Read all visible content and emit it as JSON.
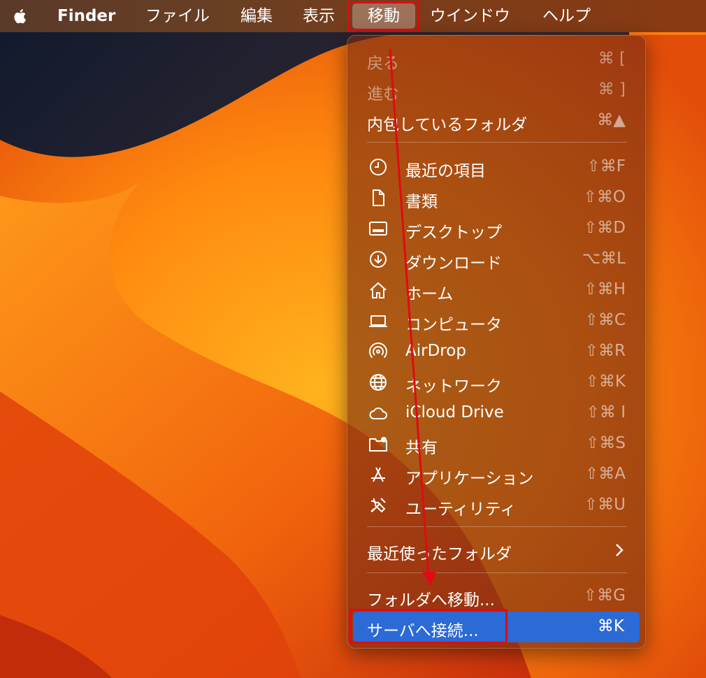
{
  "menubar": {
    "app_name": "Finder",
    "items": [
      "ファイル",
      "編集",
      "表示",
      "移動",
      "ウインドウ",
      "ヘルプ"
    ],
    "active_item": "移動"
  },
  "menu": {
    "back": {
      "label": "戻る",
      "shortcut": "⌘ ["
    },
    "forward": {
      "label": "進む",
      "shortcut": "⌘ ]"
    },
    "enclosing": {
      "label": "内包しているフォルダ",
      "shortcut": "⌘▲"
    },
    "items": [
      {
        "label": "最近の項目",
        "shortcut": "⇧⌘F",
        "icon": "clock-icon"
      },
      {
        "label": "書類",
        "shortcut": "⇧⌘O",
        "icon": "document-icon"
      },
      {
        "label": "デスクトップ",
        "shortcut": "⇧⌘D",
        "icon": "desktop-icon"
      },
      {
        "label": "ダウンロード",
        "shortcut": "⌥⌘L",
        "icon": "download-icon"
      },
      {
        "label": "ホーム",
        "shortcut": "⇧⌘H",
        "icon": "home-icon"
      },
      {
        "label": "コンピュータ",
        "shortcut": "⇧⌘C",
        "icon": "laptop-icon"
      },
      {
        "label": "AirDrop",
        "shortcut": "⇧⌘R",
        "icon": "airdrop-icon"
      },
      {
        "label": "ネットワーク",
        "shortcut": "⇧⌘K",
        "icon": "globe-icon"
      },
      {
        "label": "iCloud Drive",
        "shortcut": "⇧⌘ I",
        "icon": "cloud-icon"
      },
      {
        "label": "共有",
        "shortcut": "⇧⌘S",
        "icon": "shared-folder-icon"
      },
      {
        "label": "アプリケーション",
        "shortcut": "⇧⌘A",
        "icon": "applications-icon"
      },
      {
        "label": "ユーティリティ",
        "shortcut": "⇧⌘U",
        "icon": "tools-icon"
      }
    ],
    "recent_folders": {
      "label": "最近使ったフォルダ"
    },
    "go_to_folder": {
      "label": "フォルダへ移動...",
      "shortcut": "⇧⌘G"
    },
    "connect_server": {
      "label": "サーバへ接続...",
      "shortcut": "⌘K"
    }
  },
  "colors": {
    "highlight": "#2c6ad6",
    "annotation_red": "#e10a14"
  }
}
